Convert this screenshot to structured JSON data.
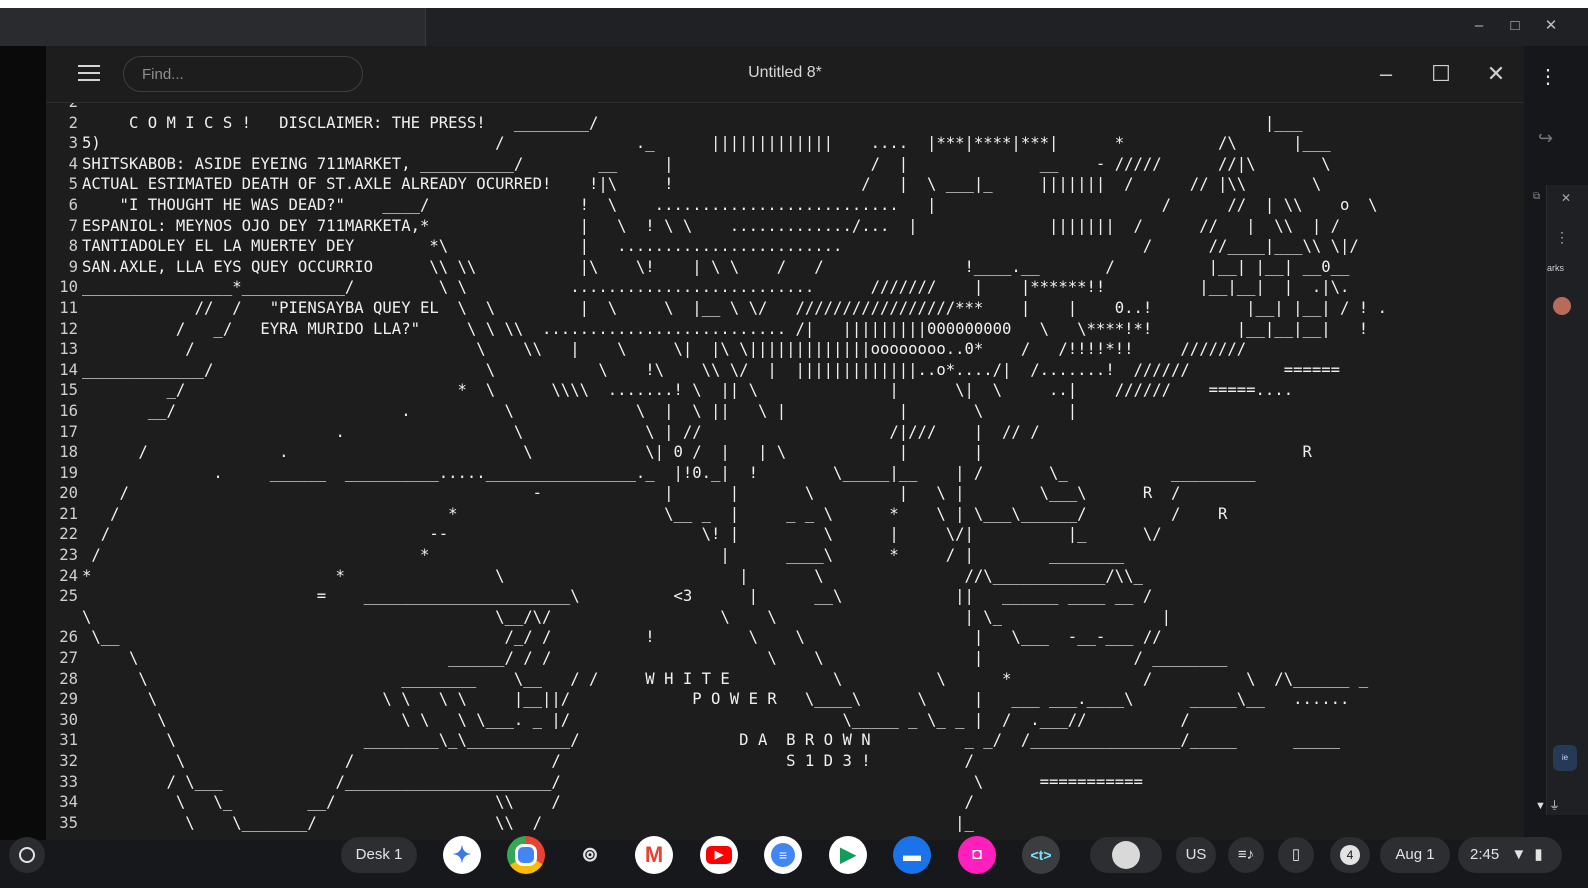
{
  "window": {
    "title": "Untitled 8*",
    "search_placeholder": "Find...",
    "menu_icon": "hamburger-icon",
    "controls": [
      "minimize",
      "maximize",
      "close"
    ]
  },
  "editor": {
    "line_numbers": [
      "2",
      "2",
      "3",
      "4",
      "5",
      "6",
      "7",
      "8",
      "9",
      "10",
      "11",
      "12",
      "13",
      "14",
      "15",
      "16",
      "17",
      "18",
      "19",
      "20",
      "21",
      "22",
      "23",
      "24",
      "25",
      "",
      "26",
      "27",
      "28",
      "29",
      "30",
      "31",
      "32",
      "33",
      "34",
      "35"
    ],
    "lines": [
      "",
      "     C O M I C S !   DISCLAIMER: THE PRESS!   ________/                                                                       |___",
      "5)                                          /              ._      |||||||||||||    ....  |***|****|***|      *          /\\      |___",
      "SHITSKABOB: ASIDE EYEING 711MARKET, __________/        __     |                     /  |              __    - /////      //|\\       \\",
      "ACTUAL ESTIMATED DEATH OF ST.AXLE ALREADY OCURRED!    !|\\     !                    /   |  \\ ___|_     |||||||  /      // |\\\\       \\",
      "    \"I THOUGHT HE WAS DEAD?\"    ____/                !  \\    ..........................   |                        /      //  | \\\\    o  \\",
      "ESPANIOL: MEYNOS OJO DEY 711MARKETA,*                |   \\  ! \\ \\    ............./...  |              |||||||  /      //   |  \\\\  | /",
      "TANTIADOLEY EL LA MUERTEY DEY        *\\              |   ........................                                /      //____|___\\\\ \\|/",
      "SAN.AXLE, LLA EYS QUEY OCCURRIO      \\\\ \\\\           |\\    \\!    | \\ \\    /   /               !____.__       /          |__| |__| __0__",
      "________________*___________/         \\ \\           ..........................      ///////    |    |******!!          |__|__|  |  .|\\.",
      "            //  /   \"PIENSAYBA QUEY EL  \\  \\         |  \\     \\  |__ \\ \\/   /////////////////***    |    |    0..!          |__| |__| / ! .",
      "          /   _/   EYRA MURIDO LLA?\"     \\ \\ \\\\  .......................... /|   |||||||||000000000   \\   \\****!*!         |__|__|__|   !",
      "           /                              \\    \\\\   |    \\     \\|  |\\ \\|||||||||||||oooooooo..0*    /   /!!!!*!!     ///////",
      "_____________/                             \\           \\    !\\    \\\\ \\/  |  |||||||||||||..o*..../|  /.......!  //////          ======",
      "         _/                             *  \\      \\\\\\\\  .......! \\  || \\              |      \\|  \\     ..|    //////    =====....",
      "       __/                        .          \\             \\  |  \\ ||   \\ |            |       \\         |",
      "                           .                  \\             \\ | //                    /|///    |  // /",
      "      /              .                         \\            \\| 0 /  |   | \\            |       |                                  R",
      "              .     ______  __________.....________________._  |!0._|  !        \\_____|__    | /       \\_           _________",
      "    /                                           -             |      |       \\         |   \\ |        \\___\\      R  /",
      "   /                                   *                      \\__ _  |     _ _ \\      *    \\ | \\___\\______/         /    R",
      "  /                                  --                           \\! |         \\      |     \\/|          |_      \\/",
      " /                                  *                               |      ____\\      *     / |        ________",
      "*                          *                \\                         |       \\               //\\____________/\\\\_",
      "                         =    ______________________\\          <3      |      __\\            ||   ______ ____ __ /",
      "\\                                           \\__/\\/                  \\    \\                    | \\_                 |",
      " \\__                                         /_/ /          !          \\    \\                  |   \\___  -__-___ //",
      "     \\                                 ______/ / /                       \\    \\                |                / ________",
      "      \\                           ________    \\__   / /     W H I T E           \\          \\      *              /          \\  /\\______ _",
      "       \\                        \\ \\   \\ \\     |__||/             P O W E R   \\____\\      \\     |   ___ ___.____\\      _____\\__   ......",
      "        \\                         \\ \\   \\ \\___. _ |/                             \\_____ _ \\_ _ |  /  .___//          /",
      "         \\                    ________\\_\\___________/                 D A  B R O W N          _ _/  /________________/_____      _____",
      "          \\                 /                     /                        S 1 D 3 !          /",
      "         / \\___            /______________________/                                            \\      ===========",
      "          \\   \\_        __/                 \\\\    /                                           /",
      "           \\    \\_______/                   \\\\  /                                            |_"
    ]
  },
  "taskbar": {
    "desk_label": "Desk 1",
    "apps": [
      "gemini-icon",
      "chrome-icon",
      "podcast-icon",
      "gmail-icon",
      "youtube-icon",
      "docs-icon",
      "play-store-icon",
      "files-icon",
      "screenshot-app-icon",
      "text-editor-icon"
    ],
    "text_app_label": "<t>",
    "ime_label": "US",
    "notification_count": "4",
    "date": "Aug 1",
    "time": "2:45"
  },
  "sidepanel": {
    "bookmarks_text": "arks"
  },
  "colors": {
    "editor_bg": "#1d1d1d",
    "text": "#f0f0f0",
    "taskbar_bg": "#17181b"
  }
}
